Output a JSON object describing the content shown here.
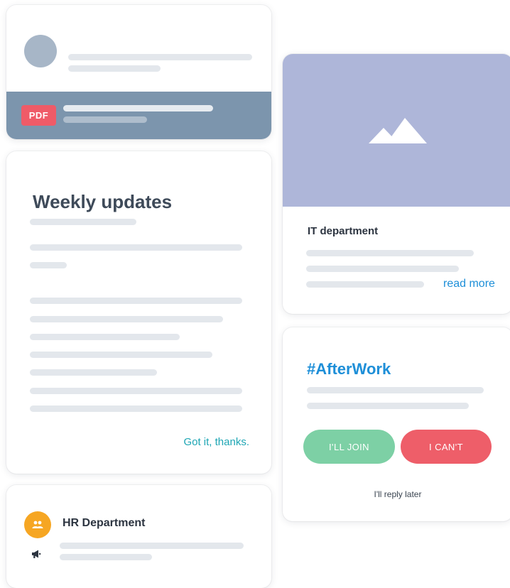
{
  "file_card": {
    "badge": "PDF"
  },
  "weekly_card": {
    "title": "Weekly updates",
    "cta": "Got it, thanks."
  },
  "hr_card": {
    "title": "HR Department",
    "badge_icon": "people-icon",
    "icon": "megaphone-icon"
  },
  "it_card": {
    "title": "IT department",
    "link": "read more",
    "image_icon": "mountains-icon"
  },
  "afterwork_card": {
    "title": "#AfterWork",
    "join_label": "I'LL JOIN",
    "decline_label": "I CAN'T",
    "later_label": "I'll reply later"
  },
  "colors": {
    "accent_blue": "#1e8fd8",
    "accent_teal": "#1ea6b4",
    "pdf_red": "#ef5b68",
    "join_green": "#7dd0a5",
    "decline_red": "#ee5e69",
    "hr_orange": "#f6a623",
    "file_band": "#7c95ad",
    "image_bg": "#aeb6d9"
  }
}
